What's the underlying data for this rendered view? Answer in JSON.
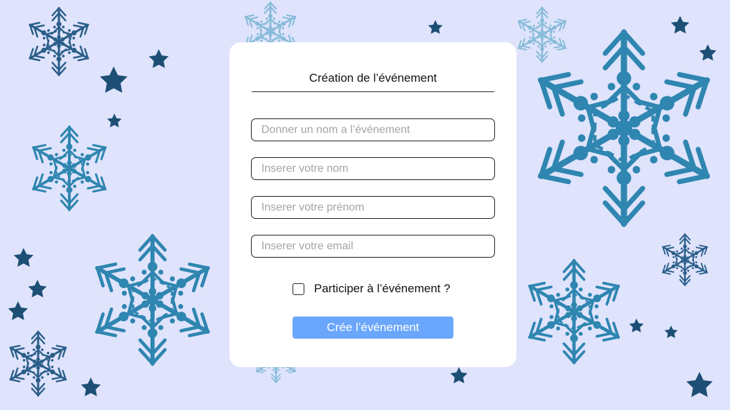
{
  "form": {
    "title": "Création de l’événement",
    "fields": [
      {
        "placeholder": "Donner un nom a l’événement",
        "value": ""
      },
      {
        "placeholder": "Inserer votre nom",
        "value": ""
      },
      {
        "placeholder": "Inserer votre prénom",
        "value": ""
      },
      {
        "placeholder": "Inserer votre email",
        "value": ""
      }
    ],
    "participate_label": "Participer à l’événement ?",
    "participate_checked": false,
    "submit_label": "Crée l’événement"
  },
  "colors": {
    "background": "#dfe3fc",
    "card": "#ffffff",
    "button": "#6aa6fb",
    "snowflake_dark": "#2a5e88",
    "snowflake_mid": "#2f86b0",
    "snowflake_light": "#86bbd8",
    "star": "#1d4f75"
  },
  "decorations": {
    "snowflake_icon": "snowflake-icon",
    "star_icon": "star-icon"
  }
}
